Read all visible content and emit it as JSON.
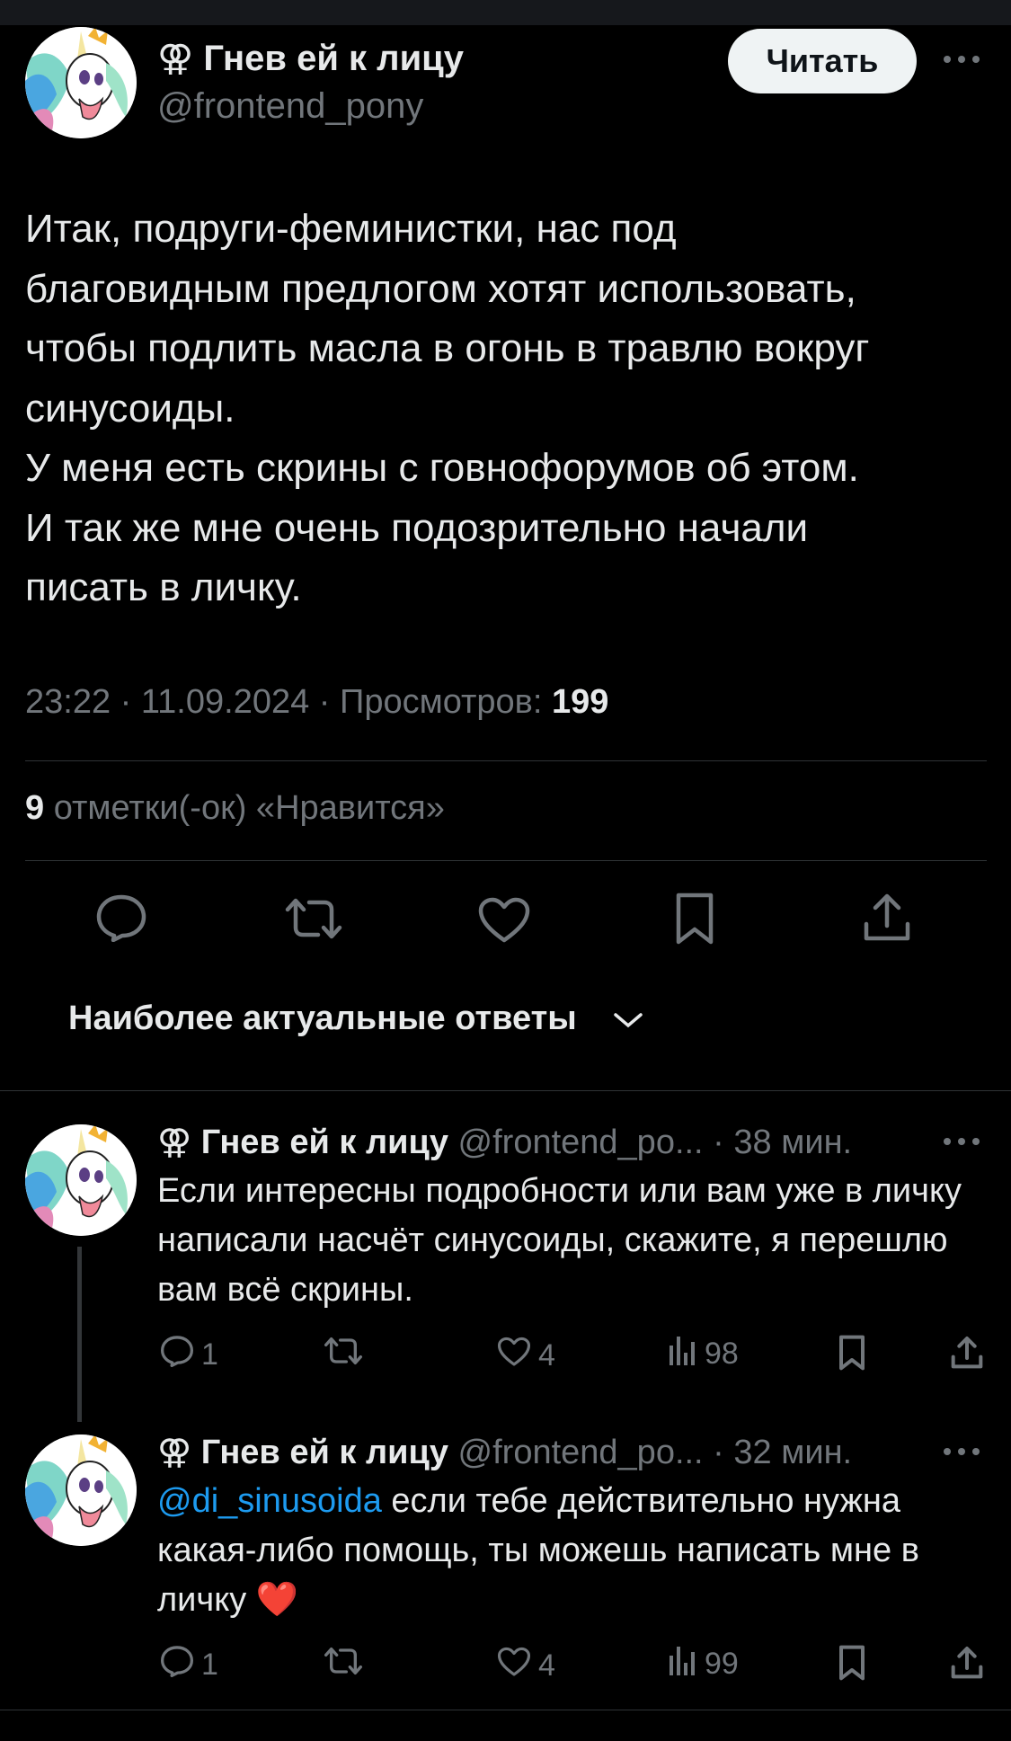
{
  "tweet": {
    "display_name": "Гнев ей к лицу",
    "name_symbol": "⚢",
    "handle": "@frontend_pony",
    "follow_label": "Читать",
    "more_icon": "more-horizontal-icon",
    "text": "Итак, подруги-феминистки, нас под\nблаговидным предлогом хотят  использовать,\nчтобы подлить масла в огонь в травлю вокруг\nсинусоиды.\nУ меня есть скрины с говнофорумов об этом.\nИ так же мне очень подозрительно начали\nписать в личку.",
    "time_date": "23:22 · 11.09.2024 · ",
    "views_label": "Просмотров: ",
    "views_count": "199",
    "likes_count": "9",
    "likes_label": " отметки(-ок) «Нравится»"
  },
  "actions": {
    "reply_icon": "reply-icon",
    "retweet_icon": "retweet-icon",
    "like_icon": "heart-icon",
    "bookmark_icon": "bookmark-icon",
    "share_icon": "share-icon"
  },
  "sort": {
    "label": "Наиболее актуальные ответы",
    "chevron": "﹀"
  },
  "replies": [
    {
      "display_name": "Гнев ей к лицу",
      "name_symbol": "⚢",
      "handle": "@frontend_po...",
      "time": " · 38 мин.",
      "text": "Если интересны подробности или вам уже в личку написали насчёт синусоиды, скажите, я перешлю вам всё скрины.",
      "replies_count": "1",
      "retweets_count": "",
      "likes_count": "4",
      "views_count": "98"
    },
    {
      "display_name": "Гнев ей к лицу",
      "name_symbol": "⚢",
      "handle": "@frontend_po...",
      "time": " · 32 мин.",
      "mention": "@di_sinusoida",
      "text": "  если тебе действительно нужна какая-либо помощь,  ты можешь написать мне в личку ",
      "emoji": "❤️",
      "replies_count": "1",
      "retweets_count": "",
      "likes_count": "4",
      "views_count": "99"
    }
  ],
  "colors": {
    "background": "#000000",
    "text_primary": "#e7e9ea",
    "text_secondary": "#71767b",
    "divider": "#2f3336",
    "link": "#1d9bf0",
    "follow_button_bg": "#eff3f4"
  }
}
